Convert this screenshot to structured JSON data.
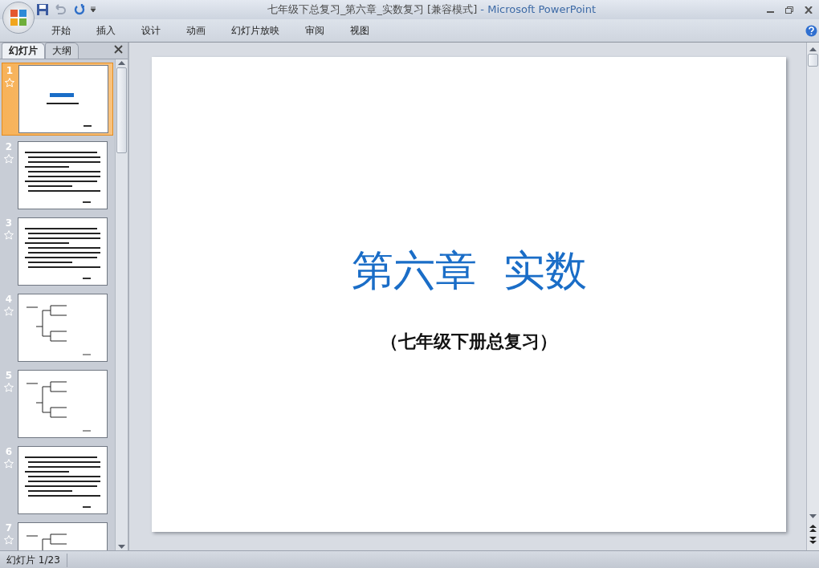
{
  "window": {
    "title": "七年级下总复习_第六章_实数复习 [兼容模式]",
    "app_name": " - Microsoft PowerPoint"
  },
  "ribbon_tabs": [
    "开始",
    "插入",
    "设计",
    "动画",
    "幻灯片放映",
    "审阅",
    "视图"
  ],
  "panel_tabs": [
    {
      "label": "幻灯片",
      "selected": true
    },
    {
      "label": "大纲",
      "selected": false
    }
  ],
  "slides": [
    {
      "number": "1",
      "kind": "title",
      "selected": true
    },
    {
      "number": "2",
      "kind": "text",
      "selected": false
    },
    {
      "number": "3",
      "kind": "text",
      "selected": false
    },
    {
      "number": "4",
      "kind": "tree",
      "selected": false
    },
    {
      "number": "5",
      "kind": "tree",
      "selected": false
    },
    {
      "number": "6",
      "kind": "text",
      "selected": false
    },
    {
      "number": "7",
      "kind": "tree",
      "selected": false
    }
  ],
  "slide": {
    "title": "第六章  实数",
    "subtitle": "（七年级下册总复习）"
  },
  "status_bar": {
    "slide_indicator": "幻灯片 1/23"
  }
}
